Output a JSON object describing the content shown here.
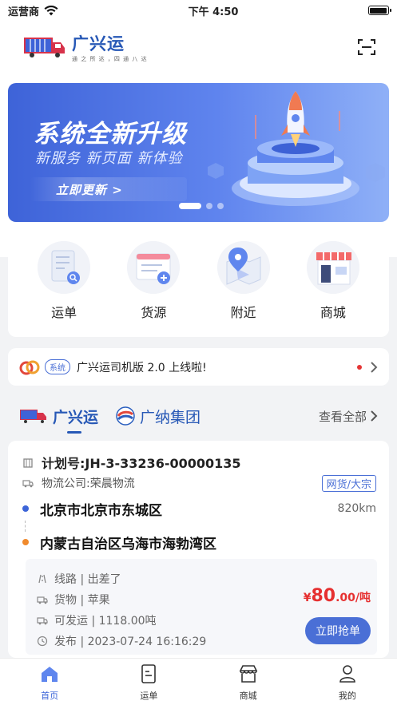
{
  "status": {
    "carrier": "运营商",
    "time": "下午 4:50"
  },
  "header": {
    "brand": "广兴运",
    "slogan": "通 之 所 达 ，四 通 八 达"
  },
  "banner": {
    "title": "系统全新升级",
    "subtitle": "新服务 新页面 新体验",
    "button": "立即更新  >"
  },
  "quick": [
    {
      "label": "运单",
      "icon": "waybill-icon"
    },
    {
      "label": "货源",
      "icon": "cargo-source-icon"
    },
    {
      "label": "附近",
      "icon": "nearby-map-icon"
    },
    {
      "label": "商城",
      "icon": "mall-icon"
    }
  ],
  "notice": {
    "badge": "系统",
    "text": "广兴运司机版 2.0 上线啦!"
  },
  "brand_tabs": {
    "tab1": "广兴运",
    "tab2": "广纳集团",
    "view_all": "查看全部"
  },
  "card": {
    "plan": "计划号:JH-3-33236-00000135",
    "company": "物流公司:荣晨物流",
    "tag": "网货/大宗",
    "from": "北京市北京市东城区",
    "to": "内蒙古自治区乌海市海勃湾区",
    "distance": "820km",
    "route_line": "线路 | 出差了",
    "goods": "货物 | 苹果",
    "available": "可发运 | 1118.00吨",
    "publish": "发布 | 2023-07-24 16:16:29",
    "price_symbol": "¥",
    "price_int": "80",
    "price_dec": ".00/吨",
    "grab": "立即抢单"
  },
  "tabbar": [
    {
      "label": "首页",
      "active": true
    },
    {
      "label": "运单",
      "active": false
    },
    {
      "label": "商城",
      "active": false
    },
    {
      "label": "我的",
      "active": false
    }
  ],
  "colors": {
    "primary": "#4a6fd6",
    "brand": "#2758b6",
    "price": "#e63030"
  }
}
